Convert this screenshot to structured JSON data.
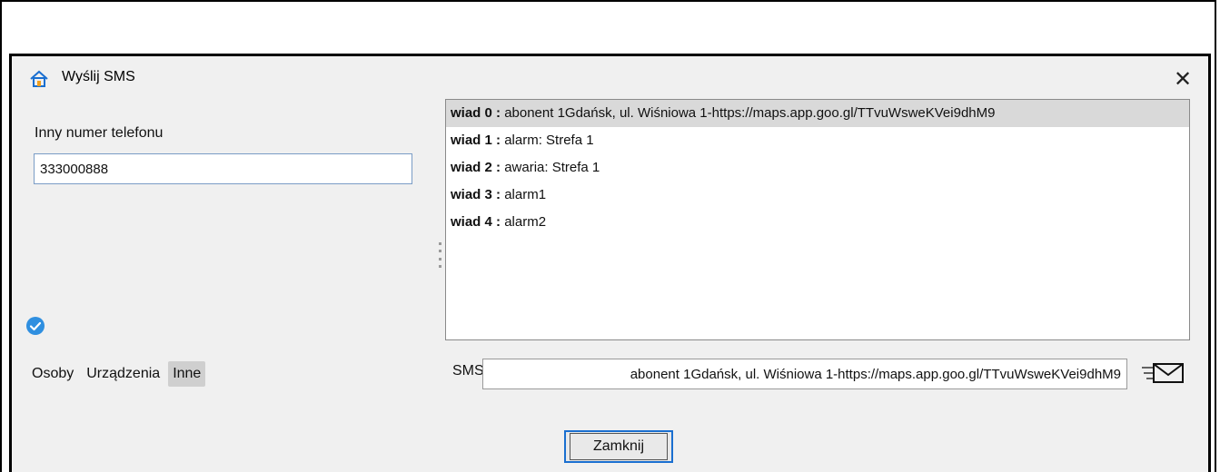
{
  "window": {
    "title": "Wyślij SMS",
    "close_glyph": "✕",
    "icon": "home-signal-icon"
  },
  "left_panel": {
    "phone_label": "Inny numer telefonu",
    "phone_value": "333000888",
    "status_icon": "check-circle-icon",
    "tabs": [
      {
        "label": "Osoby",
        "active": false
      },
      {
        "label": "Urządzenia",
        "active": false
      },
      {
        "label": "Inne",
        "active": true
      }
    ]
  },
  "messages": {
    "items": [
      {
        "key": "wiad 0 :",
        "text": "abonent 1Gdańsk, ul. Wiśniowa 1-https://maps.app.goo.gl/TTvuWsweKVei9dhM9",
        "selected": true
      },
      {
        "key": "wiad 1 :",
        "text": "alarm: Strefa 1",
        "selected": false
      },
      {
        "key": "wiad 2 :",
        "text": "awaria: Strefa 1",
        "selected": false
      },
      {
        "key": "wiad 3 :",
        "text": "alarm1",
        "selected": false
      },
      {
        "key": "wiad 4 :",
        "text": "alarm2",
        "selected": false
      }
    ]
  },
  "sms": {
    "label": "SMS",
    "value": "abonent 1Gdańsk, ul. Wiśniowa 1-https://maps.app.goo.gl/TTvuWsweKVei9dhM9",
    "send_icon": "send-envelope-icon"
  },
  "footer": {
    "close_label": "Zamknij"
  },
  "colors": {
    "accent": "#1a6fd0",
    "check": "#2f8fe0",
    "selected_row": "#d9d9d9",
    "active_tab": "#cfcfcf",
    "dialog_bg": "#f0f0f0"
  }
}
